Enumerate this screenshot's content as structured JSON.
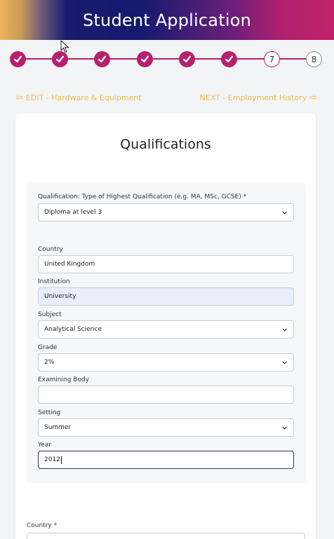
{
  "header": {
    "title": "Student Application"
  },
  "steps": {
    "items": [
      {
        "state": "done",
        "label": ""
      },
      {
        "state": "done",
        "label": ""
      },
      {
        "state": "done",
        "label": ""
      },
      {
        "state": "done",
        "label": ""
      },
      {
        "state": "done",
        "label": ""
      },
      {
        "state": "done",
        "label": ""
      },
      {
        "state": "current",
        "label": "7"
      },
      {
        "state": "pending",
        "label": "8"
      }
    ]
  },
  "nav": {
    "prev_label": "EDIT - Hardware & Equipment",
    "next_label": "NEXT - Employment History",
    "prev_arrow": "⇦",
    "next_arrow": "⇨"
  },
  "section": {
    "title": "Qualifications"
  },
  "form": {
    "qualification": {
      "label": "Qualification: Type of Highest Qualification (e.g. MA, MSc, GCSE) *",
      "value": "Diploma at level 3"
    },
    "country": {
      "label": "Country",
      "value": "United Kingdom"
    },
    "institution": {
      "label": "Institution",
      "value": "University"
    },
    "subject": {
      "label": "Subject",
      "value": "Analytical Science"
    },
    "grade": {
      "label": "Grade",
      "value": "2%"
    },
    "examining_body": {
      "label": "Examining Body",
      "value": ""
    },
    "setting": {
      "label": "Setting",
      "value": "Summer"
    },
    "year": {
      "label": "Year",
      "value": "2012"
    }
  },
  "outer": {
    "country_label": "Country *"
  },
  "colors": {
    "accent": "#b8206e",
    "nav": "#f2b94e",
    "header_dark": "#141a6e"
  }
}
